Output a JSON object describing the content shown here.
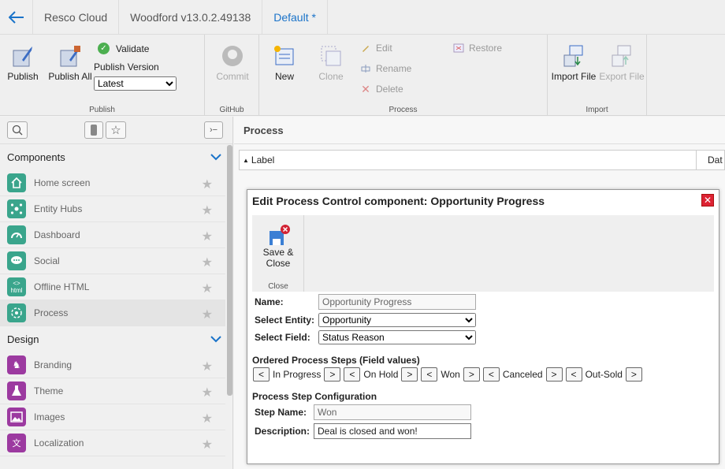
{
  "topbar": {
    "crumbs": [
      "Resco Cloud",
      "Woodford v13.0.2.49138",
      "Default *"
    ]
  },
  "ribbon": {
    "publish": {
      "publish_label": "Publish",
      "publish_all_label": "Publish All",
      "validate_label": "Validate",
      "publish_version_label": "Publish Version",
      "publish_version_value": "Latest",
      "group_label": "Publish"
    },
    "github": {
      "commit_label": "Commit",
      "group_label": "GitHub"
    },
    "process": {
      "new_label": "New",
      "clone_label": "Clone",
      "edit_label": "Edit",
      "rename_label": "Rename",
      "delete_label": "Delete",
      "restore_label": "Restore",
      "group_label": "Process"
    },
    "import": {
      "import_file_label": "Import File",
      "export_file_label": "Export File",
      "group_label": "Import"
    }
  },
  "sidebar": {
    "components_title": "Components",
    "components": [
      {
        "label": "Home screen",
        "color": "#3aa58c"
      },
      {
        "label": "Entity Hubs",
        "color": "#3aa58c"
      },
      {
        "label": "Dashboard",
        "color": "#3aa58c"
      },
      {
        "label": "Social",
        "color": "#3aa58c"
      },
      {
        "label": "Offline HTML",
        "color": "#3aa58c",
        "icon_text": "html"
      },
      {
        "label": "Process",
        "color": "#3aa58c"
      }
    ],
    "design_title": "Design",
    "design": [
      {
        "label": "Branding",
        "color": "#9c3aa0"
      },
      {
        "label": "Theme",
        "color": "#9c3aa0"
      },
      {
        "label": "Images",
        "color": "#9c3aa0"
      },
      {
        "label": "Localization",
        "color": "#9c3aa0"
      }
    ]
  },
  "main": {
    "title": "Process",
    "grid_columns": [
      "Label",
      "Dat"
    ]
  },
  "dialog": {
    "title": "Edit Process Control component: Opportunity Progress",
    "save_close_label_1": "Save &",
    "save_close_label_2": "Close",
    "close_group_label": "Close",
    "name_label": "Name:",
    "name_value": "Opportunity Progress",
    "entity_label": "Select Entity:",
    "entity_value": "Opportunity",
    "field_label": "Select Field:",
    "field_value": "Status Reason",
    "steps_title": "Ordered Process Steps (Field values)",
    "steps": [
      "In Progress",
      "On Hold",
      "Won",
      "Canceled",
      "Out-Sold"
    ],
    "config_title": "Process Step Configuration",
    "step_name_label": "Step Name:",
    "step_name_value": "Won",
    "description_label": "Description:",
    "description_value": "Deal is closed and won!"
  },
  "colors": {
    "accent": "#1a73c9",
    "close_red": "#d22233",
    "green": "#3aa58c",
    "purple": "#9c3aa0"
  }
}
